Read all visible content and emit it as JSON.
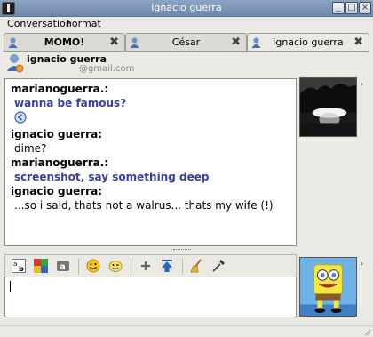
{
  "window": {
    "title": "ignacio guerra"
  },
  "menu": {
    "conversation": "Conversation",
    "format": "Format"
  },
  "tabs": [
    {
      "label": "MOMO!"
    },
    {
      "label": "César"
    },
    {
      "label": "ignacio guerra"
    }
  ],
  "contact": {
    "name": "ignacio guerra",
    "email": "@gmail.com"
  },
  "messages": [
    {
      "nick": "marianoguerra.:",
      "text": "wanna be famous?"
    },
    {
      "nick": "ignacio guerra:",
      "text": "dime?"
    },
    {
      "nick": "marianoguerra.:",
      "text": "screenshot, say something deep"
    },
    {
      "nick": "ignacio guerra:",
      "text": "...so i said, thats not a walrus... thats my wife (!)"
    }
  ],
  "colors": {
    "my_message": "#3a3fa2",
    "titlebar": "#7a93b6"
  },
  "icons": {
    "toolbar": [
      "font-icon",
      "color-icon",
      "text-style-icon",
      "smiley-icon",
      "wink-icon",
      "add-icon",
      "upload-icon",
      "clear-icon",
      "pick-icon"
    ]
  }
}
